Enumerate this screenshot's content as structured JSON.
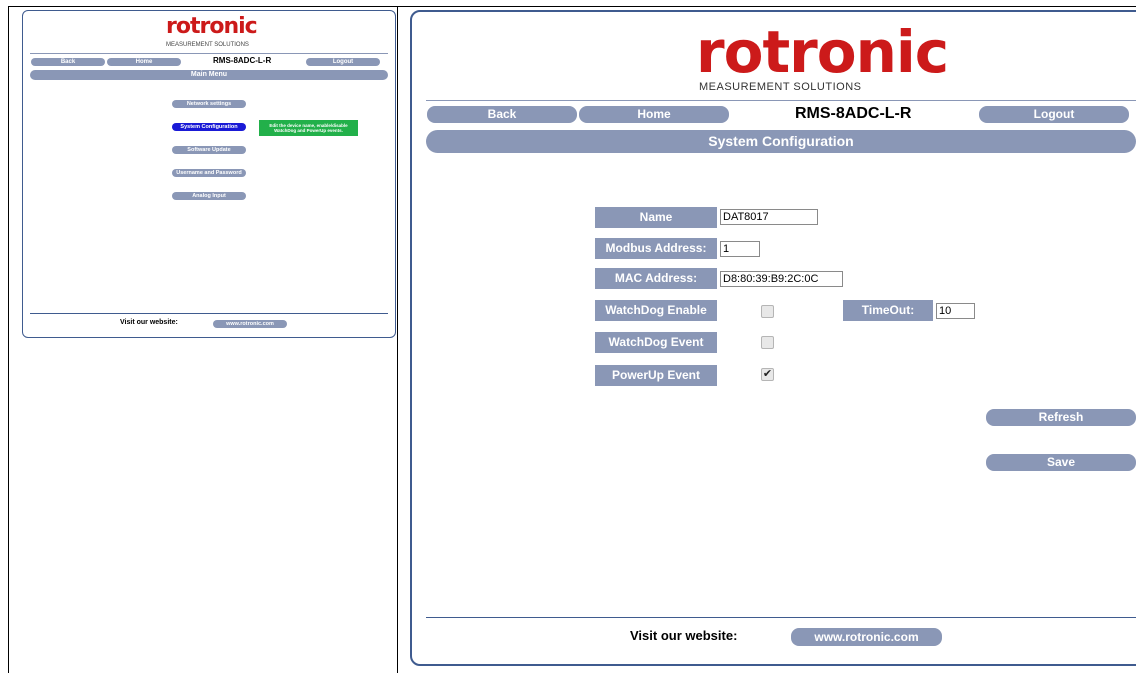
{
  "brand": {
    "name": "rotronic",
    "tagline": "MEASUREMENT SOLUTIONS"
  },
  "nav": {
    "back": "Back",
    "home": "Home",
    "device": "RMS-8ADC-L-R",
    "logout": "Logout"
  },
  "left_panel": {
    "heading": "Main Menu",
    "menu": [
      {
        "label": "Network settings",
        "active": false
      },
      {
        "label": "System Configuration",
        "active": true
      },
      {
        "label": "Software Update",
        "active": false
      },
      {
        "label": "Username and Password",
        "active": false
      },
      {
        "label": "Analog Input",
        "active": false
      }
    ],
    "tooltip": "Edit the device name, enable/disable WatchDog and PowerUp events."
  },
  "right_panel": {
    "heading": "System Configuration",
    "fields": {
      "name": {
        "label": "Name",
        "value": "DAT8017"
      },
      "modbus": {
        "label": "Modbus Address:",
        "value": "1"
      },
      "mac": {
        "label": "MAC Address:",
        "value": "D8:80:39:B9:2C:0C"
      },
      "watchdog_enable": {
        "label": "WatchDog Enable",
        "checked": false
      },
      "timeout": {
        "label": "TimeOut:",
        "value": "10"
      },
      "watchdog_event": {
        "label": "WatchDog Event",
        "checked": false
      },
      "powerup_event": {
        "label": "PowerUp Event",
        "checked": true
      }
    },
    "buttons": {
      "refresh": "Refresh",
      "save": "Save"
    }
  },
  "footer": {
    "visit": "Visit our website:",
    "url": "www.rotronic.com"
  },
  "colors": {
    "pill": "#8a97b6",
    "frame": "#3f5b8f",
    "logo": "#cc1a1a",
    "active": "#1a1ad6",
    "tooltip": "#22b04a"
  }
}
